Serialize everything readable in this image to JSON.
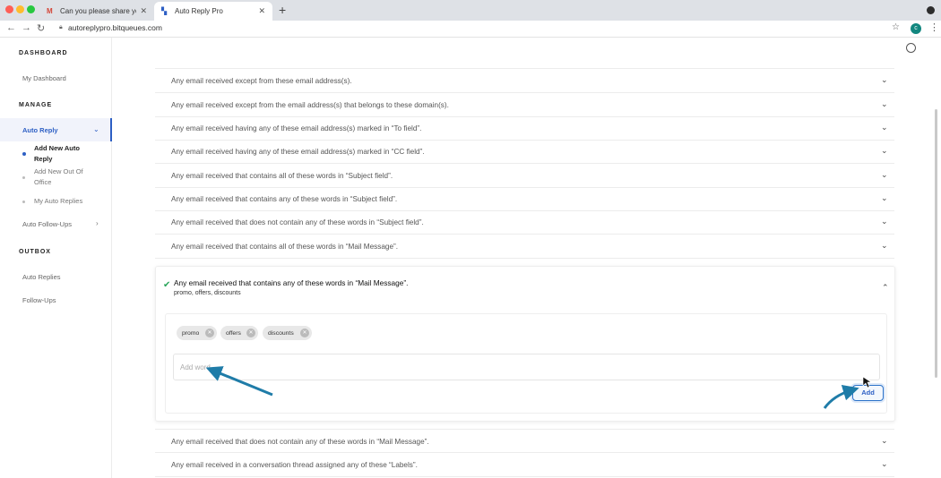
{
  "browser": {
    "tabs": [
      {
        "title": "Can you please share your m",
        "favicon": "gmail-icon"
      },
      {
        "title": "Auto Reply Pro",
        "favicon": "app-icon"
      }
    ],
    "url": "autoreplypro.bitqueues.com",
    "profile_initial": "c"
  },
  "sidebar": {
    "dashboard_header": "DASHBOARD",
    "my_dashboard": "My Dashboard",
    "manage_header": "MANAGE",
    "auto_reply": "Auto Reply",
    "sub_items": [
      "Add New Auto Reply",
      "Add New Out Of Office",
      "My Auto Replies"
    ],
    "auto_followups": "Auto Follow-Ups",
    "outbox_header": "OUTBOX",
    "auto_replies": "Auto Replies",
    "followups": "Follow-Ups"
  },
  "rules": [
    "Any email received except from these email address(s).",
    "Any email received except from the email address(s) that belongs to these domain(s).",
    "Any email received having any of these email address(s) marked in “To field”.",
    "Any email received having any of these email address(s) marked in “CC field”.",
    "Any email received that contains all of these words in “Subject field”.",
    "Any email received that contains any of these words in “Subject field”.",
    "Any email received that does not contain any of these words in “Subject field”.",
    "Any email received that contains all of these words in “Mail Message”."
  ],
  "expanded_rule": {
    "title": "Any email received that contains any of these words in “Mail Message”.",
    "summary": "promo, offers, discounts",
    "chips": [
      "promo",
      "offers",
      "discounts"
    ],
    "input_placeholder": "Add word",
    "add_label": "Add"
  },
  "rules_after": [
    "Any email received that does not contain any of these words in “Mail Message”.",
    "Any email received in a conversation thread assigned any of these “Labels”."
  ],
  "colors": {
    "accent": "#2d5fc4",
    "check": "#2aa55a",
    "annotation_arrow": "#1f7ca8"
  }
}
